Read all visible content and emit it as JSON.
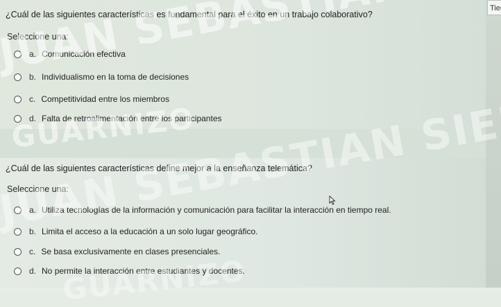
{
  "timer": {
    "label": "Tien"
  },
  "questions": [
    {
      "text": "¿Cuál de las siguientes características es fundamental para el éxito en un trabajo colaborativo?",
      "prompt": "Seleccione una:",
      "options": [
        {
          "letter": "a.",
          "label": "Comunicación efectiva"
        },
        {
          "letter": "b.",
          "label": "Individualismo en la toma de decisiones"
        },
        {
          "letter": "c.",
          "label": "Competitividad entre los miembros"
        },
        {
          "letter": "d.",
          "label": "Falta de retroalimentación entre los participantes"
        }
      ]
    },
    {
      "text": "¿Cuál de las siguientes características define mejor a la enseñanza telemática?",
      "prompt": "Seleccione una:",
      "options": [
        {
          "letter": "a.",
          "label": "Utiliza tecnologías de la información y comunicación para facilitar la interacción en tiempo real."
        },
        {
          "letter": "b.",
          "label": "Limita el acceso a la educación a un solo lugar geográfico."
        },
        {
          "letter": "c.",
          "label": "Se basa exclusivamente en clases presenciales."
        },
        {
          "letter": "d.",
          "label": "No permite la interacción entre estudiantes y docentes."
        }
      ]
    }
  ],
  "watermark": {
    "line1": "JUAN SEBASTIAN SIERRA",
    "line2": "GUARNIZO"
  }
}
